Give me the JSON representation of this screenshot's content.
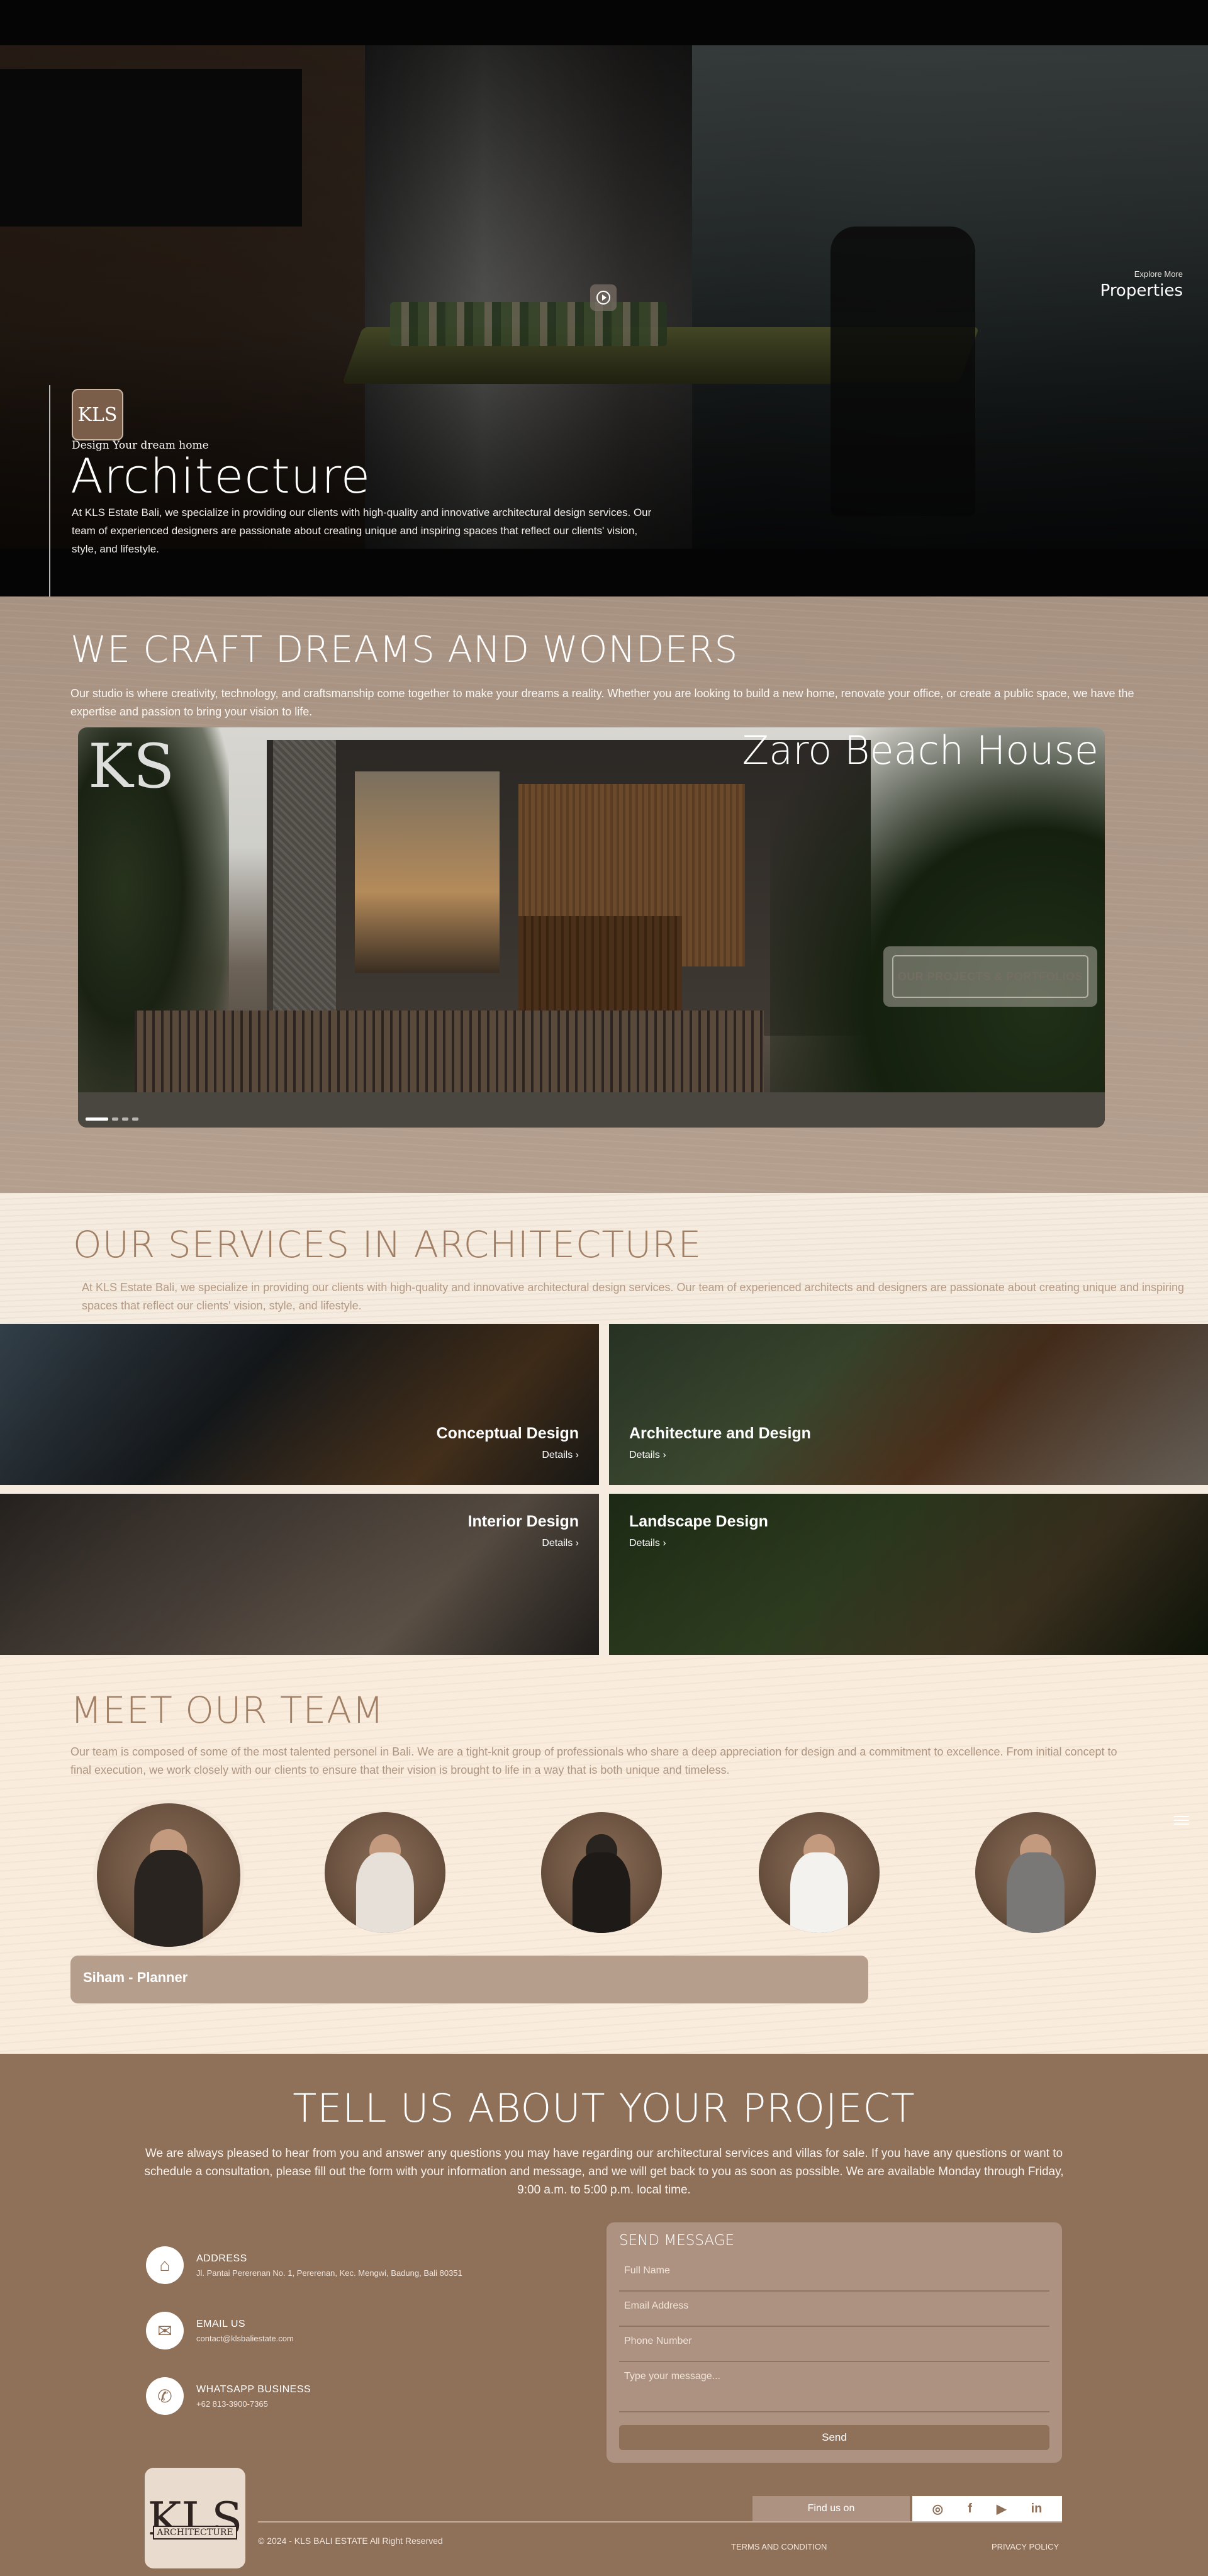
{
  "hero": {
    "explore_small": "Explore More",
    "explore_link": "Properties",
    "logo_text": "KLS",
    "eyebrow": "Design Your dream home",
    "title": "Architecture",
    "description": "At KLS Estate Bali, we specialize in providing our clients with high-quality and innovative architectural design services. Our team of experienced designers are passionate about creating unique and inspiring spaces that reflect our clients' vision, style, and lifestyle."
  },
  "craft": {
    "title": "WE CRAFT DREAMS AND WONDERS",
    "description": "Our studio is where creativity, technology, and craftsmanship come together to make your dreams a reality. Whether you are looking to build a new home, renovate your office, or create a public space, we have the expertise and passion to bring your vision to life.",
    "slide": {
      "logo": "KS",
      "title": "Zaro Beach House",
      "cta": "OUR PROJECTS & PORTFOLIOS",
      "slides_count": 4,
      "active_slide": 1
    }
  },
  "services": {
    "title": "OUR SERVICES IN ARCHITECTURE",
    "description": "At KLS Estate Bali, we specialize in providing our clients with high-quality and innovative architectural design services. Our team of experienced architects and designers are passionate about creating unique and inspiring spaces that reflect our clients' vision, style, and lifestyle.",
    "details_label": "Details",
    "items": [
      {
        "name": "Conceptual Design"
      },
      {
        "name": "Architecture and Design"
      },
      {
        "name": "Interior Design"
      },
      {
        "name": "Landscape Design"
      }
    ]
  },
  "team": {
    "title": "MEET OUR TEAM",
    "description": "Our team is composed of some of the most talented personel in Bali. We are a tight-knit group of professionals who share a deep appreciation for design and a commitment to excellence. From initial concept to final execution, we work closely with our clients to ensure that their vision is brought to life in a way that is both unique and timeless.",
    "selected_member": "Siham - Planner",
    "members_count": 5
  },
  "contact": {
    "title": "TELL US ABOUT YOUR PROJECT",
    "description": "We are always pleased to hear from you and answer any questions you may have regarding our architectural services and villas for sale. If you have any questions or want to schedule a consultation, please fill out the form with your information and message, and we will get back to you as soon as possible. We are available Monday through Friday, 9:00 a.m. to 5:00 p.m. local time.",
    "address_label": "ADDRESS",
    "address_value": "Jl. Pantai Pererenan No. 1, Pererenan, Kec. Mengwi, Badung, Bali 80351",
    "email_label": "EMAIL US",
    "email_value": "contact@klsbaliestate.com",
    "whatsapp_label": "WHATSAPP BUSINESS",
    "whatsapp_value": "+62 813-3900-7365",
    "form": {
      "title": "SEND MESSAGE",
      "full_name": "Full Name",
      "email": "Email Address",
      "phone": "Phone Number",
      "message": "Type your message...",
      "send": "Send"
    }
  },
  "footer": {
    "logo_text": "KLS",
    "logo_sub": "ARCHITECTURE",
    "find_us": "Find us on",
    "socials": [
      "instagram-icon",
      "facebook-icon",
      "youtube-icon",
      "linkedin-icon"
    ],
    "copyright": "© 2024 - KLS BALI ESTATE All Right Reserved",
    "terms": "TERMS AND CONDITION",
    "privacy": "PRIVACY POLICY"
  }
}
